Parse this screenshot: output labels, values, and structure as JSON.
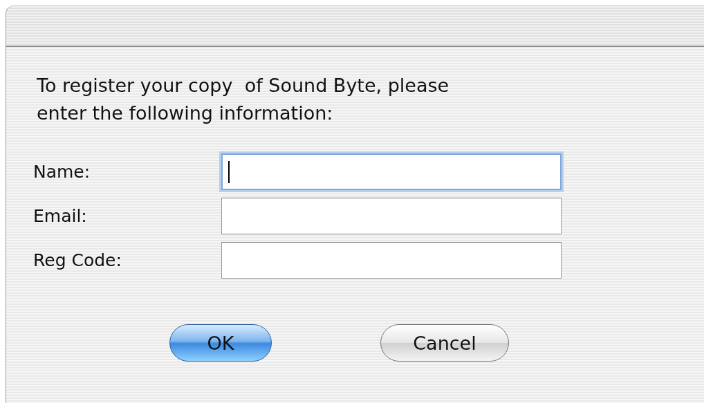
{
  "dialog": {
    "message": "To register your copy  of Sound Byte, please\nenter the following information:",
    "fields": [
      {
        "label": "Name:",
        "focused": true
      },
      {
        "label": "Email:",
        "focused": false
      },
      {
        "label": "Reg Code:",
        "focused": false
      }
    ],
    "buttons": [
      {
        "label": "OK",
        "kind": "default"
      },
      {
        "label": "Cancel",
        "kind": "normal"
      }
    ]
  }
}
